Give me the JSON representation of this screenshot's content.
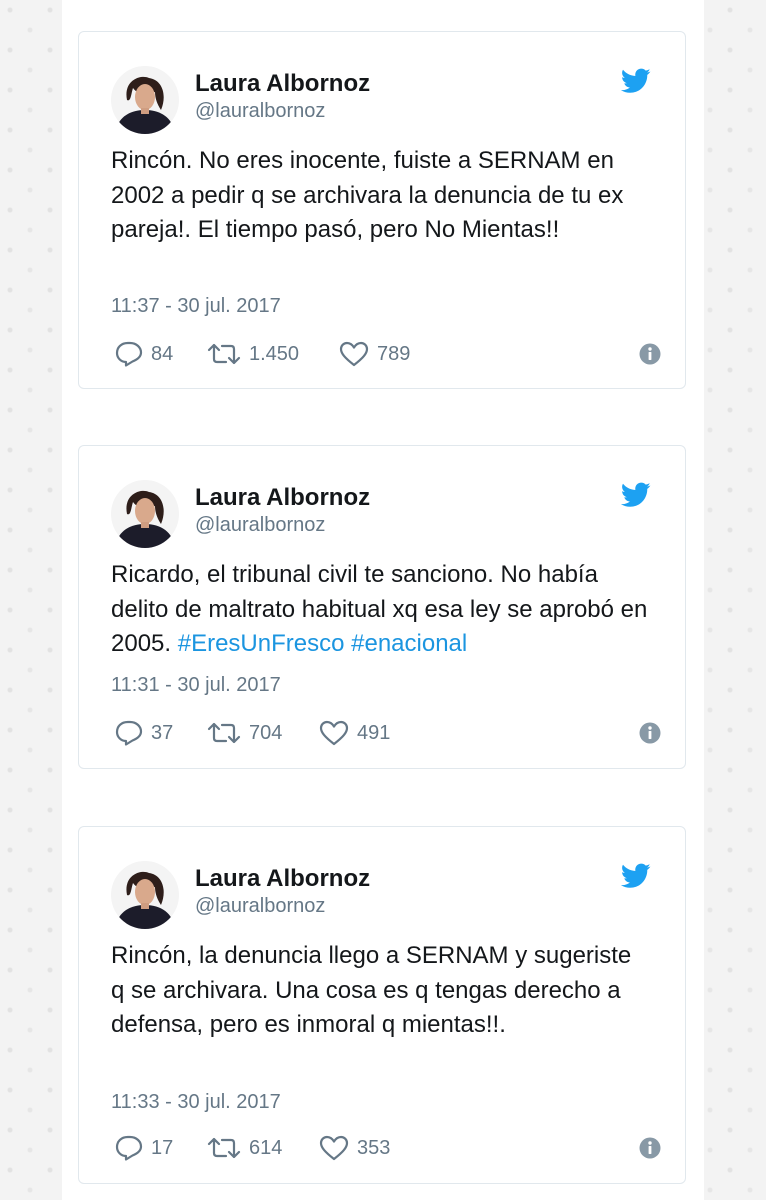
{
  "tweets": [
    {
      "name": "Laura Albornoz",
      "handle": "@lauralbornoz",
      "text": "Rincón. No eres inocente, fuiste a SERNAM en 2002 a pedir q se archivara la denuncia de tu ex pareja!. El tiempo pasó, pero No Mientas!!",
      "hashtags": [],
      "time": "11:37 - 30 jul. 2017",
      "replies": "84",
      "retweets": "1.450",
      "likes": "789"
    },
    {
      "name": "Laura Albornoz",
      "handle": "@lauralbornoz",
      "text": "Ricardo, el tribunal civil te sanciono. No había delito de maltrato habitual xq esa ley se aprobó en 2005.",
      "hashtags": [
        "#EresUnFresco",
        "#enacional"
      ],
      "time": "11:31 - 30 jul. 2017",
      "replies": "37",
      "retweets": "704",
      "likes": "491"
    },
    {
      "name": "Laura Albornoz",
      "handle": "@lauralbornoz",
      "text": "Rincón, la denuncia llego a SERNAM y sugeriste q se archivara. Una cosa es q tengas derecho a defensa, pero es inmoral q mientas!!.",
      "hashtags": [],
      "time": "11:33 - 30 jul. 2017",
      "replies": "17",
      "retweets": "614",
      "likes": "353"
    }
  ],
  "icons": {
    "brand": "twitter-bird-icon",
    "reply": "reply-icon",
    "retweet": "retweet-icon",
    "like": "heart-icon",
    "info": "info-icon"
  },
  "colors": {
    "brand_blue": "#1da1f2",
    "hashtag_blue": "#1b95e0",
    "text": "#14171a",
    "muted": "#657786",
    "border": "#e1e8ed"
  }
}
